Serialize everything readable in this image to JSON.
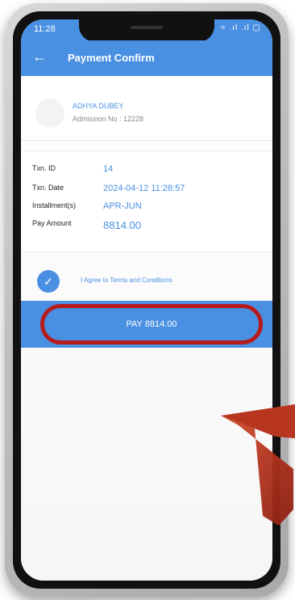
{
  "status": {
    "time": "11:28",
    "icons": "≈ .ıl .ıl ▢"
  },
  "appbar": {
    "back_icon": "←",
    "title": "Payment Confirm"
  },
  "student": {
    "name": "ADHYA DUBEY",
    "admission": "Admission No : 12228"
  },
  "details": {
    "rows": [
      {
        "label": "Txn. ID",
        "value": "14"
      },
      {
        "label": "Txn. Date",
        "value": "2024-04-12 11:28:57"
      },
      {
        "label": "Installment(s)",
        "value": "APR-JUN"
      },
      {
        "label": "Pay Amount",
        "value": "8814.00"
      }
    ]
  },
  "agree": {
    "check_icon": "✓",
    "text": "I Agree to Terms and Conditions"
  },
  "pay": {
    "label": "PAY 8814.00"
  },
  "colors": {
    "accent": "#4a90e2",
    "highlight": "#b71c1c"
  }
}
